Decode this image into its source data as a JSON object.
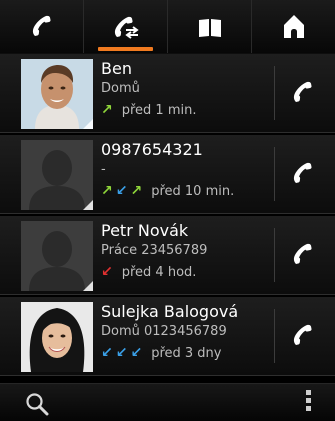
{
  "tabs": [
    {
      "id": "calls",
      "icon": "handset-icon",
      "active": false
    },
    {
      "id": "call-log",
      "icon": "call-log-icon",
      "active": true
    },
    {
      "id": "contacts",
      "icon": "book-icon",
      "active": false
    },
    {
      "id": "home",
      "icon": "house-icon",
      "active": false
    }
  ],
  "calls": [
    {
      "name": "Ben",
      "sub": "Domů",
      "directions": [
        "outgoing"
      ],
      "time": "před 1 min.",
      "photo": "man-photo"
    },
    {
      "name": "0987654321",
      "sub": "-",
      "directions": [
        "outgoing",
        "incoming",
        "outgoing"
      ],
      "time": "před 10 min.",
      "photo": "placeholder"
    },
    {
      "name": "Petr Novák",
      "sub": "Práce 23456789",
      "directions": [
        "missed"
      ],
      "time": "před 4 hod.",
      "photo": "placeholder"
    },
    {
      "name": "Sulejka Balogová",
      "sub": "Domů 0123456789",
      "directions": [
        "incoming",
        "incoming",
        "incoming"
      ],
      "time": "před 3 dny",
      "photo": "woman-photo"
    }
  ],
  "colors": {
    "accent": "#f07a20",
    "outgoing": "#8fd63a",
    "incoming": "#3aa0e8",
    "missed": "#e23030"
  },
  "bottombar": {
    "search_icon": "magnifier-icon",
    "menu_icon": "overflow-menu-icon"
  }
}
